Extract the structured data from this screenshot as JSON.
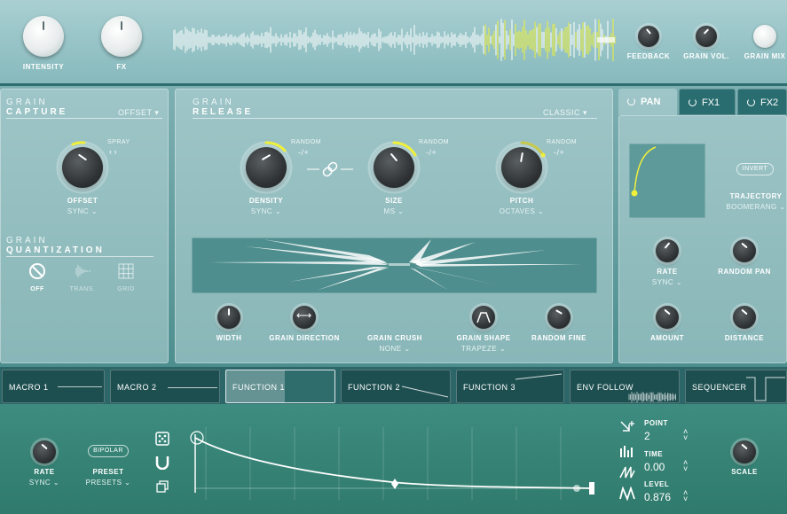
{
  "top": {
    "intensity_label": "INTENSITY",
    "fx_label": "FX",
    "feedback_label": "FEEDBACK",
    "grain_vol_label": "GRAIN VOL.",
    "grain_mix_label": "GRAIN MIX"
  },
  "capture": {
    "title1": "GRAIN",
    "title2": "CAPTURE",
    "mode": "OFFSET",
    "spray_label": "SPRAY",
    "offset_label": "OFFSET",
    "offset_sub": "SYNC",
    "quant_title1": "GRAIN",
    "quant_title2": "QUANTIZATION",
    "quant_off": "OFF",
    "quant_trans": "TRANS.",
    "quant_grid": "GRID"
  },
  "release": {
    "title1": "GRAIN",
    "title2": "RELEASE",
    "mode": "CLASSIC",
    "random_label": "RANDOM",
    "random_value": "-/+",
    "density_label": "DENSITY",
    "density_sub": "SYNC",
    "size_label": "SIZE",
    "size_sub": "MS",
    "pitch_label": "PITCH",
    "pitch_sub": "OCTAVES",
    "width_label": "WIDTH",
    "direction_label": "GRAIN DIRECTION",
    "crush_label": "GRAIN CRUSH",
    "crush_sub": "NONE",
    "shape_label": "GRAIN SHAPE",
    "shape_sub": "TRAPEZE",
    "random_fine_label": "RANDOM FINE"
  },
  "pan": {
    "tabs": [
      "PAN",
      "FX1",
      "FX2"
    ],
    "invert_label": "INVERT",
    "trajectory_label": "TRAJECTORY",
    "trajectory_sub": "BOOMERANG",
    "rate_label": "RATE",
    "rate_sub": "SYNC",
    "random_pan_label": "RANDOM PAN",
    "amount_label": "AMOUNT",
    "distance_label": "DISTANCE"
  },
  "macros": [
    "MACRO 1",
    "MACRO 2",
    "FUNCTION 1",
    "FUNCTION 2",
    "FUNCTION 3",
    "ENV FOLLOW",
    "SEQUENCER"
  ],
  "function_editor": {
    "rate_label": "RATE",
    "rate_sub": "SYNC",
    "bipolar_label": "BIPOLAR",
    "preset_label": "PRESET",
    "preset_sub": "PRESETS",
    "point_label": "POINT",
    "point_value": "2",
    "time_label": "TIME",
    "time_value": "0.00",
    "level_label": "LEVEL",
    "level_value": "0.876",
    "scale_label": "SCALE"
  },
  "colors": {
    "accent": "#f0f03a",
    "dark_teal": "#1f5656"
  }
}
